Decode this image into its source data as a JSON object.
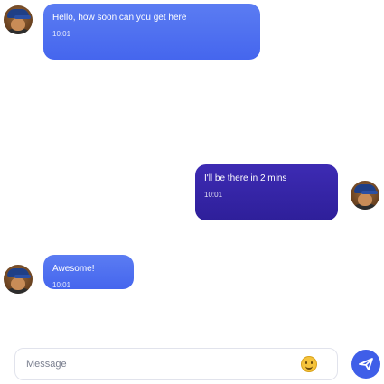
{
  "messages": [
    {
      "sender": "contact",
      "text": "Hello, how soon can you get here",
      "time": "10:01"
    },
    {
      "sender": "user",
      "text": "I'll be there in 2 mins",
      "time": "10:01"
    },
    {
      "sender": "contact",
      "text": "Awesome!",
      "time": "10:01"
    }
  ],
  "composer": {
    "placeholder": "Message"
  },
  "icons": {
    "emoji": "emoji-smile-icon",
    "send": "send-arrow-icon"
  },
  "colors": {
    "contact_bubble": "#4f6ff0",
    "user_bubble": "#3726a8",
    "send_button": "#3f5ee8"
  }
}
